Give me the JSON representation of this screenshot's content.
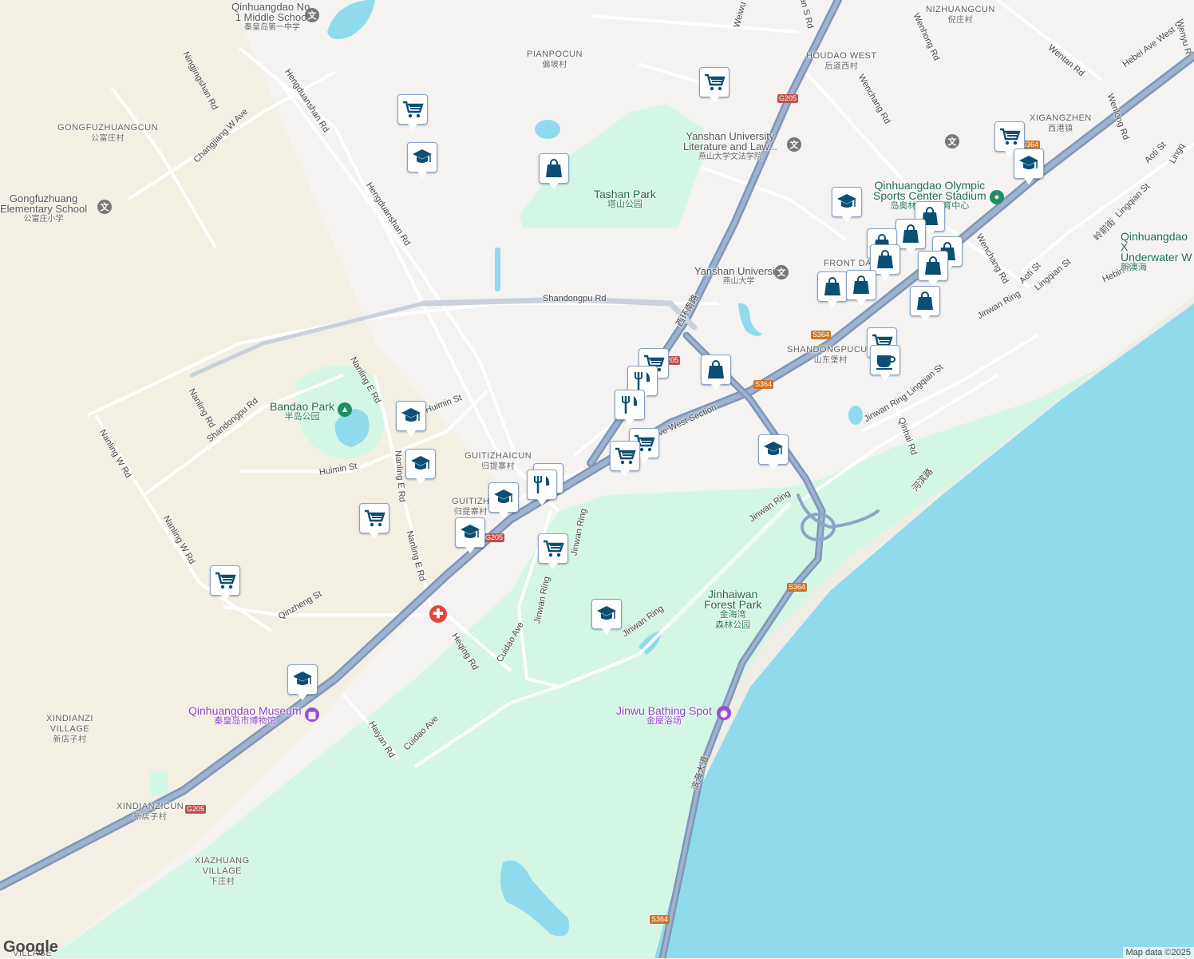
{
  "map": {
    "colors": {
      "land": "#f4f3f2",
      "rural": "#f3efe4",
      "park": "#d4f6e5",
      "water": "#90daee",
      "highway": "#8da4c6",
      "road": "#ffffff",
      "marker_icon": "#0b4f74"
    },
    "labels": {
      "qh_middle_school": {
        "en": "Qinhuangdao No.\n1 Middle School",
        "zh": "秦皇岛第一中学"
      },
      "gongfuzhuangcun": {
        "en": "GONGFUZHUANGCUN",
        "zh": "公富庄村"
      },
      "gongfuzhuang_school": {
        "en": "Gongfuzhuang\nElementary School",
        "zh": "公富庄小学"
      },
      "pianpocun": {
        "en": "PIANPOCUN",
        "zh": "偏坡村"
      },
      "tashan_park": {
        "en": "Tashan Park",
        "zh": "塔山公园"
      },
      "yanshan_law": {
        "en": "Yanshan University\nLiterature and Law...",
        "zh": "燕山大学文法学院"
      },
      "yanshan_univ": {
        "en": "Yanshan University",
        "zh": "燕山大学"
      },
      "houdao_west": {
        "en": "HOUDAO WEST",
        "zh": "后道西村"
      },
      "nizhuangcun": {
        "en": "NIZHUANGCUN",
        "zh": "倪庄村"
      },
      "xigangzhen": {
        "en": "XIGANGZHEN",
        "zh": "西港镇"
      },
      "olympic": {
        "en": "Qinhuangdao Olympic\nSports Center Stadium",
        "zh": "岛奥林匹克体育中心"
      },
      "underwater": {
        "en": "Qinhuangdao X\nUnderwater W",
        "zh": "新澳海"
      },
      "front_da": {
        "en": "FRONT DA",
        "zh": ""
      },
      "shandongpucun": {
        "en": "SHANDONGPUCUN",
        "zh": "山东堡村"
      },
      "bandao_park": {
        "en": "Bandao Park",
        "zh": "半岛公园"
      },
      "guitizhaicun": {
        "en": "GUITIZHAICUN",
        "zh": "归提寨村"
      },
      "guitizh": {
        "en": "GUITIZH",
        "zh": "归提寨村"
      },
      "jinhaiwan": {
        "en": "Jinhaiwan\nForest Park",
        "zh": "金海湾\n森林公园"
      },
      "jinwu": {
        "en": "Jinwu Bathing Spot",
        "zh": "金屋浴场"
      },
      "museum": {
        "en": "Qinhuangdao Museum",
        "zh": "秦皇岛市博物馆"
      },
      "xindianzi_village": {
        "en": "XINDIANZI\nVILLAGE",
        "zh": "新店子村"
      },
      "xindianzicun": {
        "en": "XINDIANZICUN",
        "zh": "新店子村"
      },
      "xiazhuang": {
        "en": "XIAZHUANG\nVILLAGE",
        "zh": "下庄村"
      },
      "village_cut": {
        "en": "VILLAGE",
        "zh": ""
      }
    },
    "roads": {
      "hengduanshan1": "Hengduanshan Rd",
      "hengduanshan2": "Hengduanshan Rd",
      "ningjingshan": "Ningjingshan Rd",
      "changjiang": "Changjiang W Ave",
      "shandongpu": "Shandongpu Rd",
      "shandongpu2": "Shandongpu Rd",
      "nanling_e1": "Nanling E Rd",
      "nanling_e2": "Nanling E Rd",
      "nanling_e3": "Nanling E Rd",
      "nanling": "Nanling Rd",
      "nanling_w1": "Nanling W Rd",
      "nanling_w2": "Nanling W Rd",
      "huimin1": "Huimin St",
      "huimin2": "Huimin St",
      "qinzheng": "Qinzheng St",
      "heqing": "Heqing Rd",
      "haiyan": "Haiyan Rd",
      "cuidao1": "Cuidao Ave",
      "cuidao2": "Cuidao Ave",
      "jinwan1": "Jinwan Ring",
      "jinwan2": "Jinwan Ring",
      "jinwan3": "Jinwan Ring",
      "jinwan4": "Jinwan Ring",
      "jinwan5": "Jinwan Ring",
      "jinwan6": "Jinwan Ring",
      "west_section": "Ave West Section",
      "xihuan": "西环南路",
      "weiwu": "Weiwu Rd",
      "an_s": "an S Rd",
      "wenchang1": "Wenchang Rd",
      "wenchang2": "Wenchang Rd",
      "wenhong": "Wenhong Rd",
      "wentan": "Wentan Rd",
      "wenlong": "Wenlong Rd",
      "hebei": "Hebei Ave West S",
      "aoti1": "Aoti St",
      "aoti2": "Aoti St",
      "lingqian1": "Lingqian St",
      "lingqian2": "Lingqian St",
      "lingqian3": "Lingqian St",
      "lingqian_zh": "岭前街",
      "hebin": "Hebin Rd",
      "qinhai": "Qinhai Rd",
      "hebinlu": "河滨路",
      "binhai": "滨海大道",
      "wenyu": "Wenyu R",
      "linggo": "Lingq"
    },
    "shields": [
      "G205",
      "G205",
      "G205",
      "G205",
      "S364",
      "S364",
      "S364",
      "S364",
      "S364"
    ],
    "attribution": "Map data ©2025",
    "logo": "Google"
  }
}
